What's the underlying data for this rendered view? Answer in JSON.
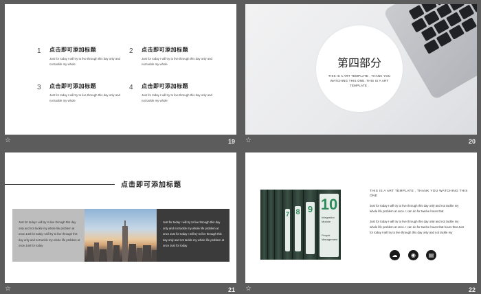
{
  "slides": {
    "s19": {
      "number": "19",
      "items": [
        {
          "n": "1",
          "title": "点击即可添加标题",
          "desc": "Just for today I will try to live through this day only and not tackle my whole"
        },
        {
          "n": "2",
          "title": "点击即可添加标题",
          "desc": "Just for today I will try to live through this day only and not tackle my whole"
        },
        {
          "n": "3",
          "title": "点击即可添加标题",
          "desc": "Just for today I will try to live through this day only and not tackle my whole"
        },
        {
          "n": "4",
          "title": "点击即可添加标题",
          "desc": "Just for today I will try to live through this day only and not tackle my whole"
        }
      ]
    },
    "s20": {
      "number": "20",
      "heading": "第四部分",
      "sub": "THIS IS A ART TEMPLATE , THANK YOU WATCHING THIS ONE. THIS IS A ART TEMPLATE ."
    },
    "s21": {
      "number": "21",
      "heading": "点击即可添加标题",
      "left_text": "Just for today I will try to live through this day only and not tackle my whole life problem at once Just for today I will try to live through this day only and not tackle my whole life problem at once Just for today",
      "right_text": "Just for today I will try to live through this day only and not tackle my whole life problem at once Just for today I will try to live through this day only and not tackle my whole life problem at once Just for today"
    },
    "s22": {
      "number": "22",
      "title": "THIS IS A ART TEMPLATE , THANK YOU WATCHING THIS ONE",
      "para1": "Just for today I will try to live through this day only and not tackle my whole life problem at once. I can do for twelve hours that",
      "para2": "Just for today I will try to live through this day only and not tackle my whole life problem at once. I can do for twelve hours that hours that Just for today I will try to live through this day only and not tackle my",
      "binder_numbers": [
        "7",
        "8",
        "9",
        "10"
      ],
      "binder_words": [
        "Integration Module",
        "People Management"
      ],
      "icons": [
        "cloud-icon",
        "eye-icon",
        "document-icon"
      ]
    }
  },
  "footer_icon": "star-outline-icon"
}
